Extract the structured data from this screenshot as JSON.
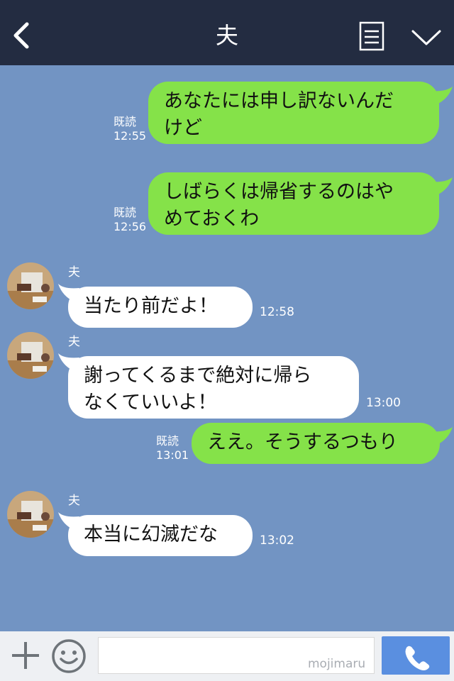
{
  "header": {
    "title": "夫"
  },
  "messages": [
    {
      "direction": "out",
      "lines": [
        "あなたには申し訳ないんだ",
        "けど"
      ],
      "read": "既読",
      "time": "12:55"
    },
    {
      "direction": "out",
      "lines": [
        "しばらくは帰省するのはや",
        "めておくわ"
      ],
      "read": "既読",
      "time": "12:56"
    },
    {
      "direction": "in",
      "sender": "夫",
      "lines": [
        "当たり前だよ！"
      ],
      "time": "12:58"
    },
    {
      "direction": "in",
      "sender": "夫",
      "lines": [
        "謝ってくるまで絶対に帰ら",
        "なくていいよ！"
      ],
      "time": "13:00"
    },
    {
      "direction": "out",
      "lines": [
        "ええ。そうするつもり"
      ],
      "read": "既読",
      "time": "13:01"
    },
    {
      "direction": "in",
      "sender": "夫",
      "lines": [
        "本当に幻滅だな"
      ],
      "time": "13:02"
    }
  ],
  "input": {
    "placeholder": "",
    "watermark": "mojimaru"
  },
  "colors": {
    "header_bg": "#232c41",
    "chat_bg": "#7294c3",
    "outgoing_bubble": "#85e249",
    "incoming_bubble": "#ffffff",
    "call_button": "#5a8fe0"
  },
  "icons": {
    "back": "chevron-left-icon",
    "menu": "document-menu-icon",
    "collapse": "chevron-down-icon",
    "add": "plus-icon",
    "emoji": "smiley-icon",
    "call": "phone-icon"
  }
}
